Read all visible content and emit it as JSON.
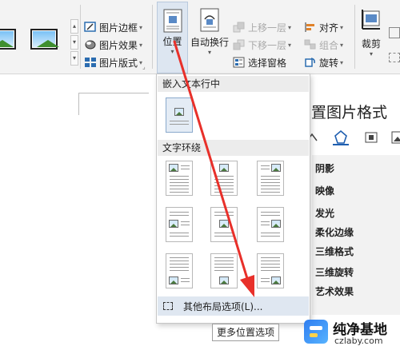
{
  "ribbon": {
    "picture_border": "图片边框",
    "picture_effects": "图片效果",
    "picture_layout": "图片版式",
    "position": "位置",
    "wrap_text": "自动换行",
    "bring_forward": "上移一层",
    "send_backward": "下移一层",
    "selection_pane": "选择窗格",
    "align": "对齐",
    "group": "组合",
    "rotate": "旋转",
    "crop": "裁剪"
  },
  "dropdown": {
    "inline_header": "嵌入文本行中",
    "wrap_header": "文字环绕",
    "more_options": "其他布局选项(L)..."
  },
  "tooltip": "更多位置选项",
  "pane": {
    "title": "设置图片格式",
    "items": [
      "阴影",
      "映像",
      "发光",
      "柔化边缘",
      "三维格式",
      "三维旋转",
      "艺术效果"
    ]
  },
  "watermark": {
    "name": "纯净基地",
    "url": "czlaby.com"
  },
  "colors": {
    "arrow": "#e8302a",
    "highlight": "#dfe7f1"
  }
}
